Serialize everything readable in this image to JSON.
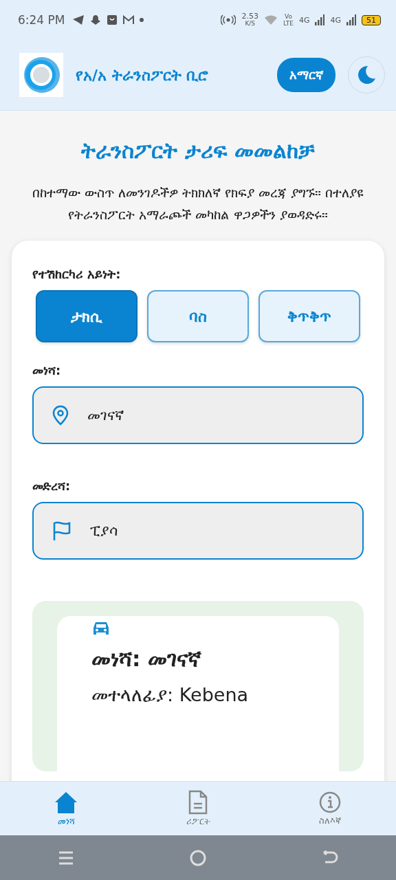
{
  "status_bar": {
    "time": "6:24 PM",
    "speed": "2.53",
    "speed_unit": "K/S",
    "volte_top": "Vo",
    "volte_bottom": "LTE",
    "network_1": "4G",
    "network_2": "4G",
    "battery": "51"
  },
  "header": {
    "title": "የአ/አ ትራንስፖርት ቢሮ",
    "language_button": "አማርኛ"
  },
  "page": {
    "title": "ትራንስፖርት ታሪፍ መመልከቻ",
    "description": "በከተማው ውስጥ ለመንገዶችዎ ትክክለኛ የክፍያ መረጃ ያግኙ። በተለያዩ የትራንስፖርት አማራጮች መካከል ዋጋዎችን ያወዳድሩ።"
  },
  "form": {
    "vehicle_label": "የተሽከርካሪ አይነት:",
    "vehicle_types": [
      {
        "label": "ታክሲ",
        "selected": true
      },
      {
        "label": "ባስ",
        "selected": false
      },
      {
        "label": "ቅጥቅጥ",
        "selected": false
      }
    ],
    "origin_label": "መነሻ:",
    "origin_value": "መገናኛ",
    "destination_label": "መድረሻ:",
    "destination_value": "ፒያሳ"
  },
  "result": {
    "origin": "መነሻ: መገናኛ",
    "transfer": "መተላለፊያ: Kebena"
  },
  "bottom_nav": [
    {
      "label": "መነሻ",
      "kind": "home",
      "selected": true
    },
    {
      "label": "ሪፖርት",
      "kind": "report",
      "selected": false
    },
    {
      "label": "ስለእኛ",
      "kind": "about",
      "selected": false
    }
  ]
}
